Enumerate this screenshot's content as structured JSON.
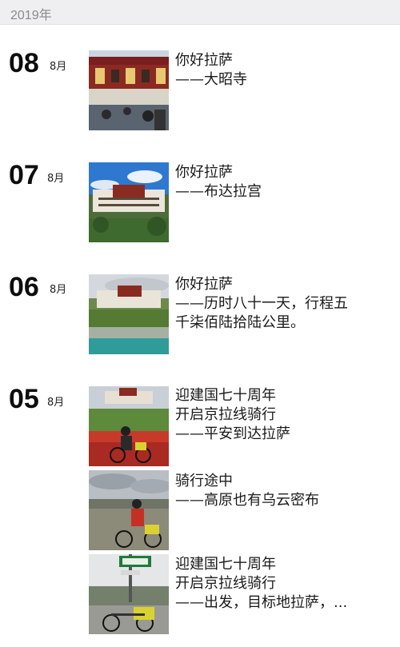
{
  "header": {
    "year": "2019年"
  },
  "days": [
    {
      "day": "08",
      "month": "8月",
      "entries": [
        {
          "lines": [
            "你好拉萨",
            "——大昭寺"
          ]
        }
      ]
    },
    {
      "day": "07",
      "month": "8月",
      "entries": [
        {
          "lines": [
            "你好拉萨",
            "——布达拉宫"
          ]
        }
      ]
    },
    {
      "day": "06",
      "month": "8月",
      "entries": [
        {
          "lines": [
            "你好拉萨",
            "——历时八十一天，行程五",
            "千柒佰陆拾陆公里。"
          ]
        }
      ]
    },
    {
      "day": "05",
      "month": "8月",
      "entries": [
        {
          "lines": [
            "迎建国七十周年",
            "开启京拉线骑行",
            "——平安到达拉萨"
          ]
        },
        {
          "lines": [
            "骑行途中",
            "——高原也有乌云密布"
          ]
        },
        {
          "lines": [
            "迎建国七十周年",
            "开启京拉线骑行",
            "——出发，目标地拉萨，..."
          ]
        }
      ]
    }
  ]
}
